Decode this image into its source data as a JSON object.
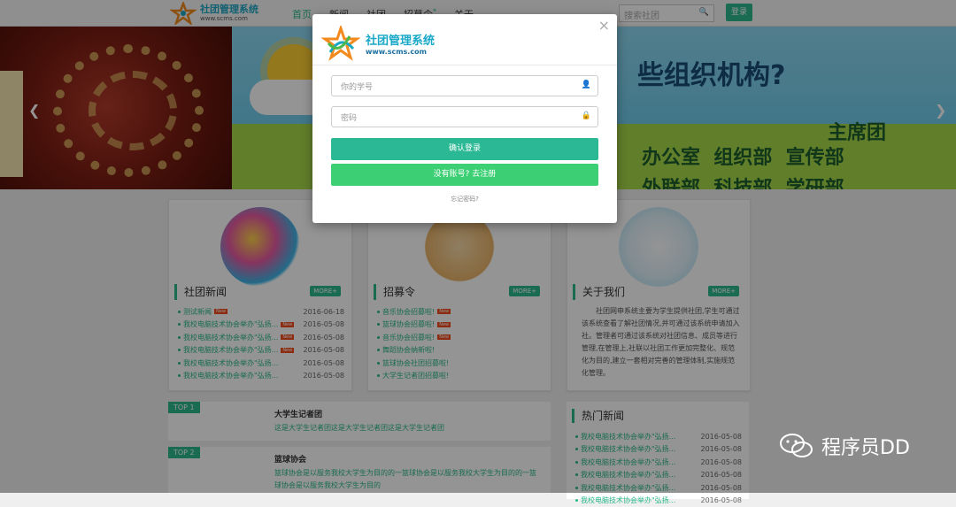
{
  "nav": {
    "logo_title": "社团管理系统",
    "logo_url": "www.scms.com",
    "items": [
      "首页",
      "新闻",
      "社团",
      "招募令",
      "关于"
    ],
    "recruit_mark": "*",
    "search_placeholder": "搜索社团",
    "login": "登录"
  },
  "banner": {
    "line1": "些组织机构?",
    "line2": "主席团",
    "line3": "办公室  组织部  宣传部",
    "line4": "外联部  科技部  学研部"
  },
  "news": {
    "title": "社团新闻",
    "more": "MORE+",
    "rows": [
      {
        "text": "测试新闻",
        "new": "New",
        "date": "2016-06-18"
      },
      {
        "text": "我校电脑技术协会举办\"弘扬...",
        "new": "New",
        "date": "2016-05-08"
      },
      {
        "text": "我校电脑技术协会举办\"弘扬...",
        "new": "New",
        "date": "2016-05-08"
      },
      {
        "text": "我校电脑技术协会举办\"弘扬...",
        "new": "New",
        "date": "2016-05-08"
      },
      {
        "text": "我校电脑技术协会举办\"弘扬...",
        "new": "",
        "date": "2016-05-08"
      },
      {
        "text": "我校电脑技术协会举办\"弘扬...",
        "new": "",
        "date": "2016-05-08"
      }
    ]
  },
  "recruit": {
    "title": "招募令",
    "more": "MORE+",
    "rows": [
      {
        "text": "音乐协会招募啦!",
        "new": "New"
      },
      {
        "text": "篮球协会招募啦!",
        "new": "New"
      },
      {
        "text": "音乐协会招募啦!",
        "new": "New"
      },
      {
        "text": "舞蹈协会纳新啦!",
        "new": ""
      },
      {
        "text": "篮球协会社团招募啦!",
        "new": ""
      },
      {
        "text": "大学生记者团招募啦!",
        "new": ""
      }
    ]
  },
  "about": {
    "title": "关于我们",
    "more": "MORE+",
    "text": "社团网申系统主要为学生提供社团,学生可通过该系统查看了解社团情况,并可通过该系统申请加入社。管理者可通过该系统对社团信息、成员等进行管理,在管理上,社联以社团工作更加完整化、规范化为目的,建立一套相对完善的管理体制,实施规范化管理。"
  },
  "tops": [
    {
      "tag": "TOP 1",
      "title": "大学生记者团",
      "desc": "这是大学生记者团这是大学生记者团这是大学生记者团"
    },
    {
      "tag": "TOP 2",
      "title": "篮球协会",
      "desc": "篮球协会是以服务我校大学生为目的的一篮球协会是以服务我校大学生为目的的一篮球协会是以服务我校大学生为目的"
    }
  ],
  "hot": {
    "title": "热门新闻",
    "rows": [
      {
        "text": "我校电脑技术协会举办\"弘扬...",
        "date": "2016-05-08"
      },
      {
        "text": "我校电脑技术协会举办\"弘扬...",
        "date": "2016-05-08"
      },
      {
        "text": "我校电脑技术协会举办\"弘扬...",
        "date": "2016-05-08"
      },
      {
        "text": "我校电脑技术协会举办\"弘扬...",
        "date": "2016-05-08"
      },
      {
        "text": "我校电脑技术协会举办\"弘扬...",
        "date": "2016-05-08"
      },
      {
        "text": "我校电脑技术协会举办\"弘扬...",
        "date": "2016-05-08"
      }
    ]
  },
  "modal": {
    "logo_title": "社团管理系统",
    "logo_url": "www.scms.com",
    "close": "×",
    "student_id_placeholder": "你的学号",
    "password_placeholder": "密码",
    "login_button": "确认登录",
    "register_button": "没有账号?  去注册",
    "forgot": "忘记密码?"
  },
  "watermark": {
    "text": "程序员DD"
  },
  "colors": {
    "accent": "#2bb88c",
    "register": "#3ccf74"
  }
}
